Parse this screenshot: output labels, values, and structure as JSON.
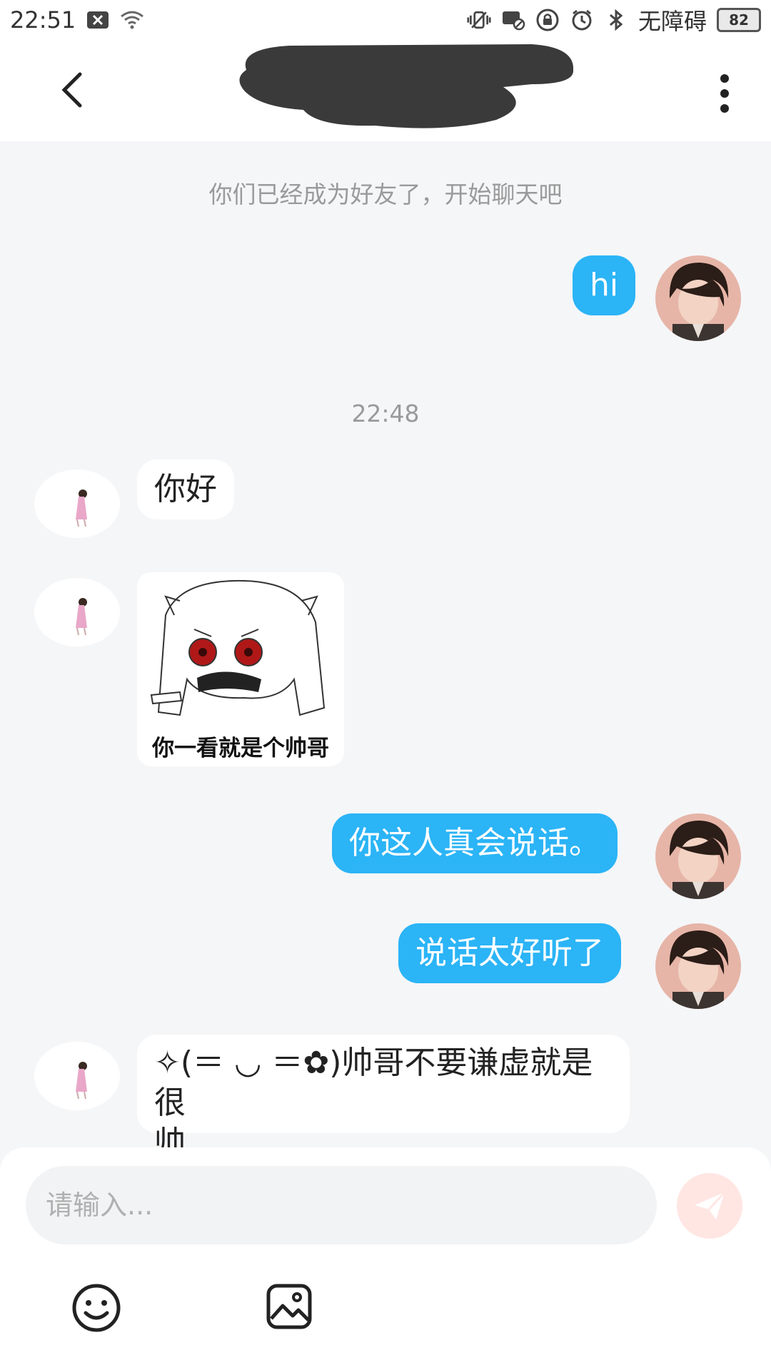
{
  "status_bar": {
    "time": "22:51",
    "accessibility": "无障碍",
    "battery": "82",
    "icons": [
      "close-box-icon",
      "wifi-icon",
      "vibrate-icon",
      "message-off-icon",
      "lock-icon",
      "alarm-icon",
      "bluetooth-icon"
    ]
  },
  "header": {
    "back_icon": "chevron-left-icon",
    "more_icon": "more-vertical-icon"
  },
  "chat": {
    "system_message": "你们已经成为好友了，开始聊天吧",
    "timestamp": "22:48",
    "messages": [
      {
        "side": "me",
        "text": "hi"
      },
      {
        "side": "them",
        "text": "你好"
      },
      {
        "side": "them",
        "type": "sticker",
        "caption": "你一看就是个帅哥"
      },
      {
        "side": "me",
        "text": "你这人真会说话。"
      },
      {
        "side": "me",
        "text": "说话太好听了"
      },
      {
        "side": "them",
        "text_line1": "✧(＝ ◡ ＝✿)帅哥不要谦虚就是很",
        "text_line2": "帅"
      }
    ]
  },
  "input": {
    "placeholder": "请输入...",
    "send_icon": "send-icon",
    "emoji_icon": "smiley-icon",
    "image_icon": "image-icon"
  },
  "colors": {
    "my_bubble": "#2bb4f6",
    "their_bubble": "#ffffff",
    "background": "#f5f6f8",
    "send_button": "#ffe6e3"
  }
}
